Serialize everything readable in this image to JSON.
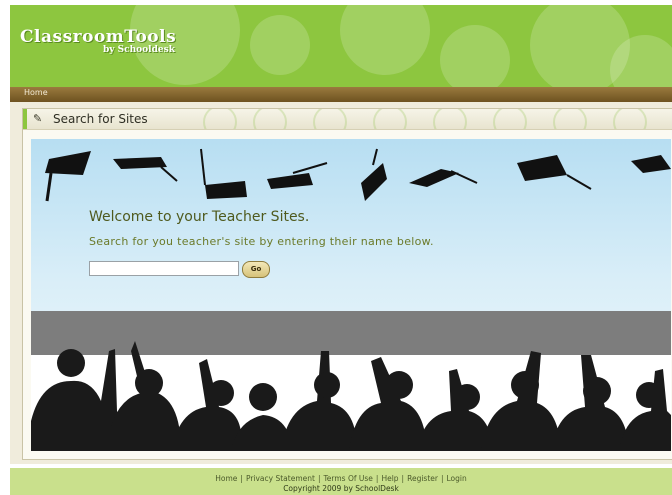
{
  "header": {
    "logo_main": "ClassroomTools",
    "logo_sub": "by Schooldesk"
  },
  "nav": {
    "home": "Home"
  },
  "panel": {
    "title": "Search for Sites",
    "icon": "pencil-icon"
  },
  "banner": {
    "welcome": "Welcome to your Teacher Sites.",
    "subtext": "Search for you teacher's site by entering their name below.",
    "search_value": "",
    "go_label": "Go"
  },
  "footer": {
    "links": [
      "Home",
      "Privacy Statement",
      "Terms Of Use",
      "Help",
      "Register",
      "Login"
    ],
    "copyright": "Copyright 2009 by SchoolDesk"
  },
  "colors": {
    "header_green": "#8dc63f",
    "nav_brown": "#7a5c28",
    "footer_green": "#c9e08c"
  }
}
